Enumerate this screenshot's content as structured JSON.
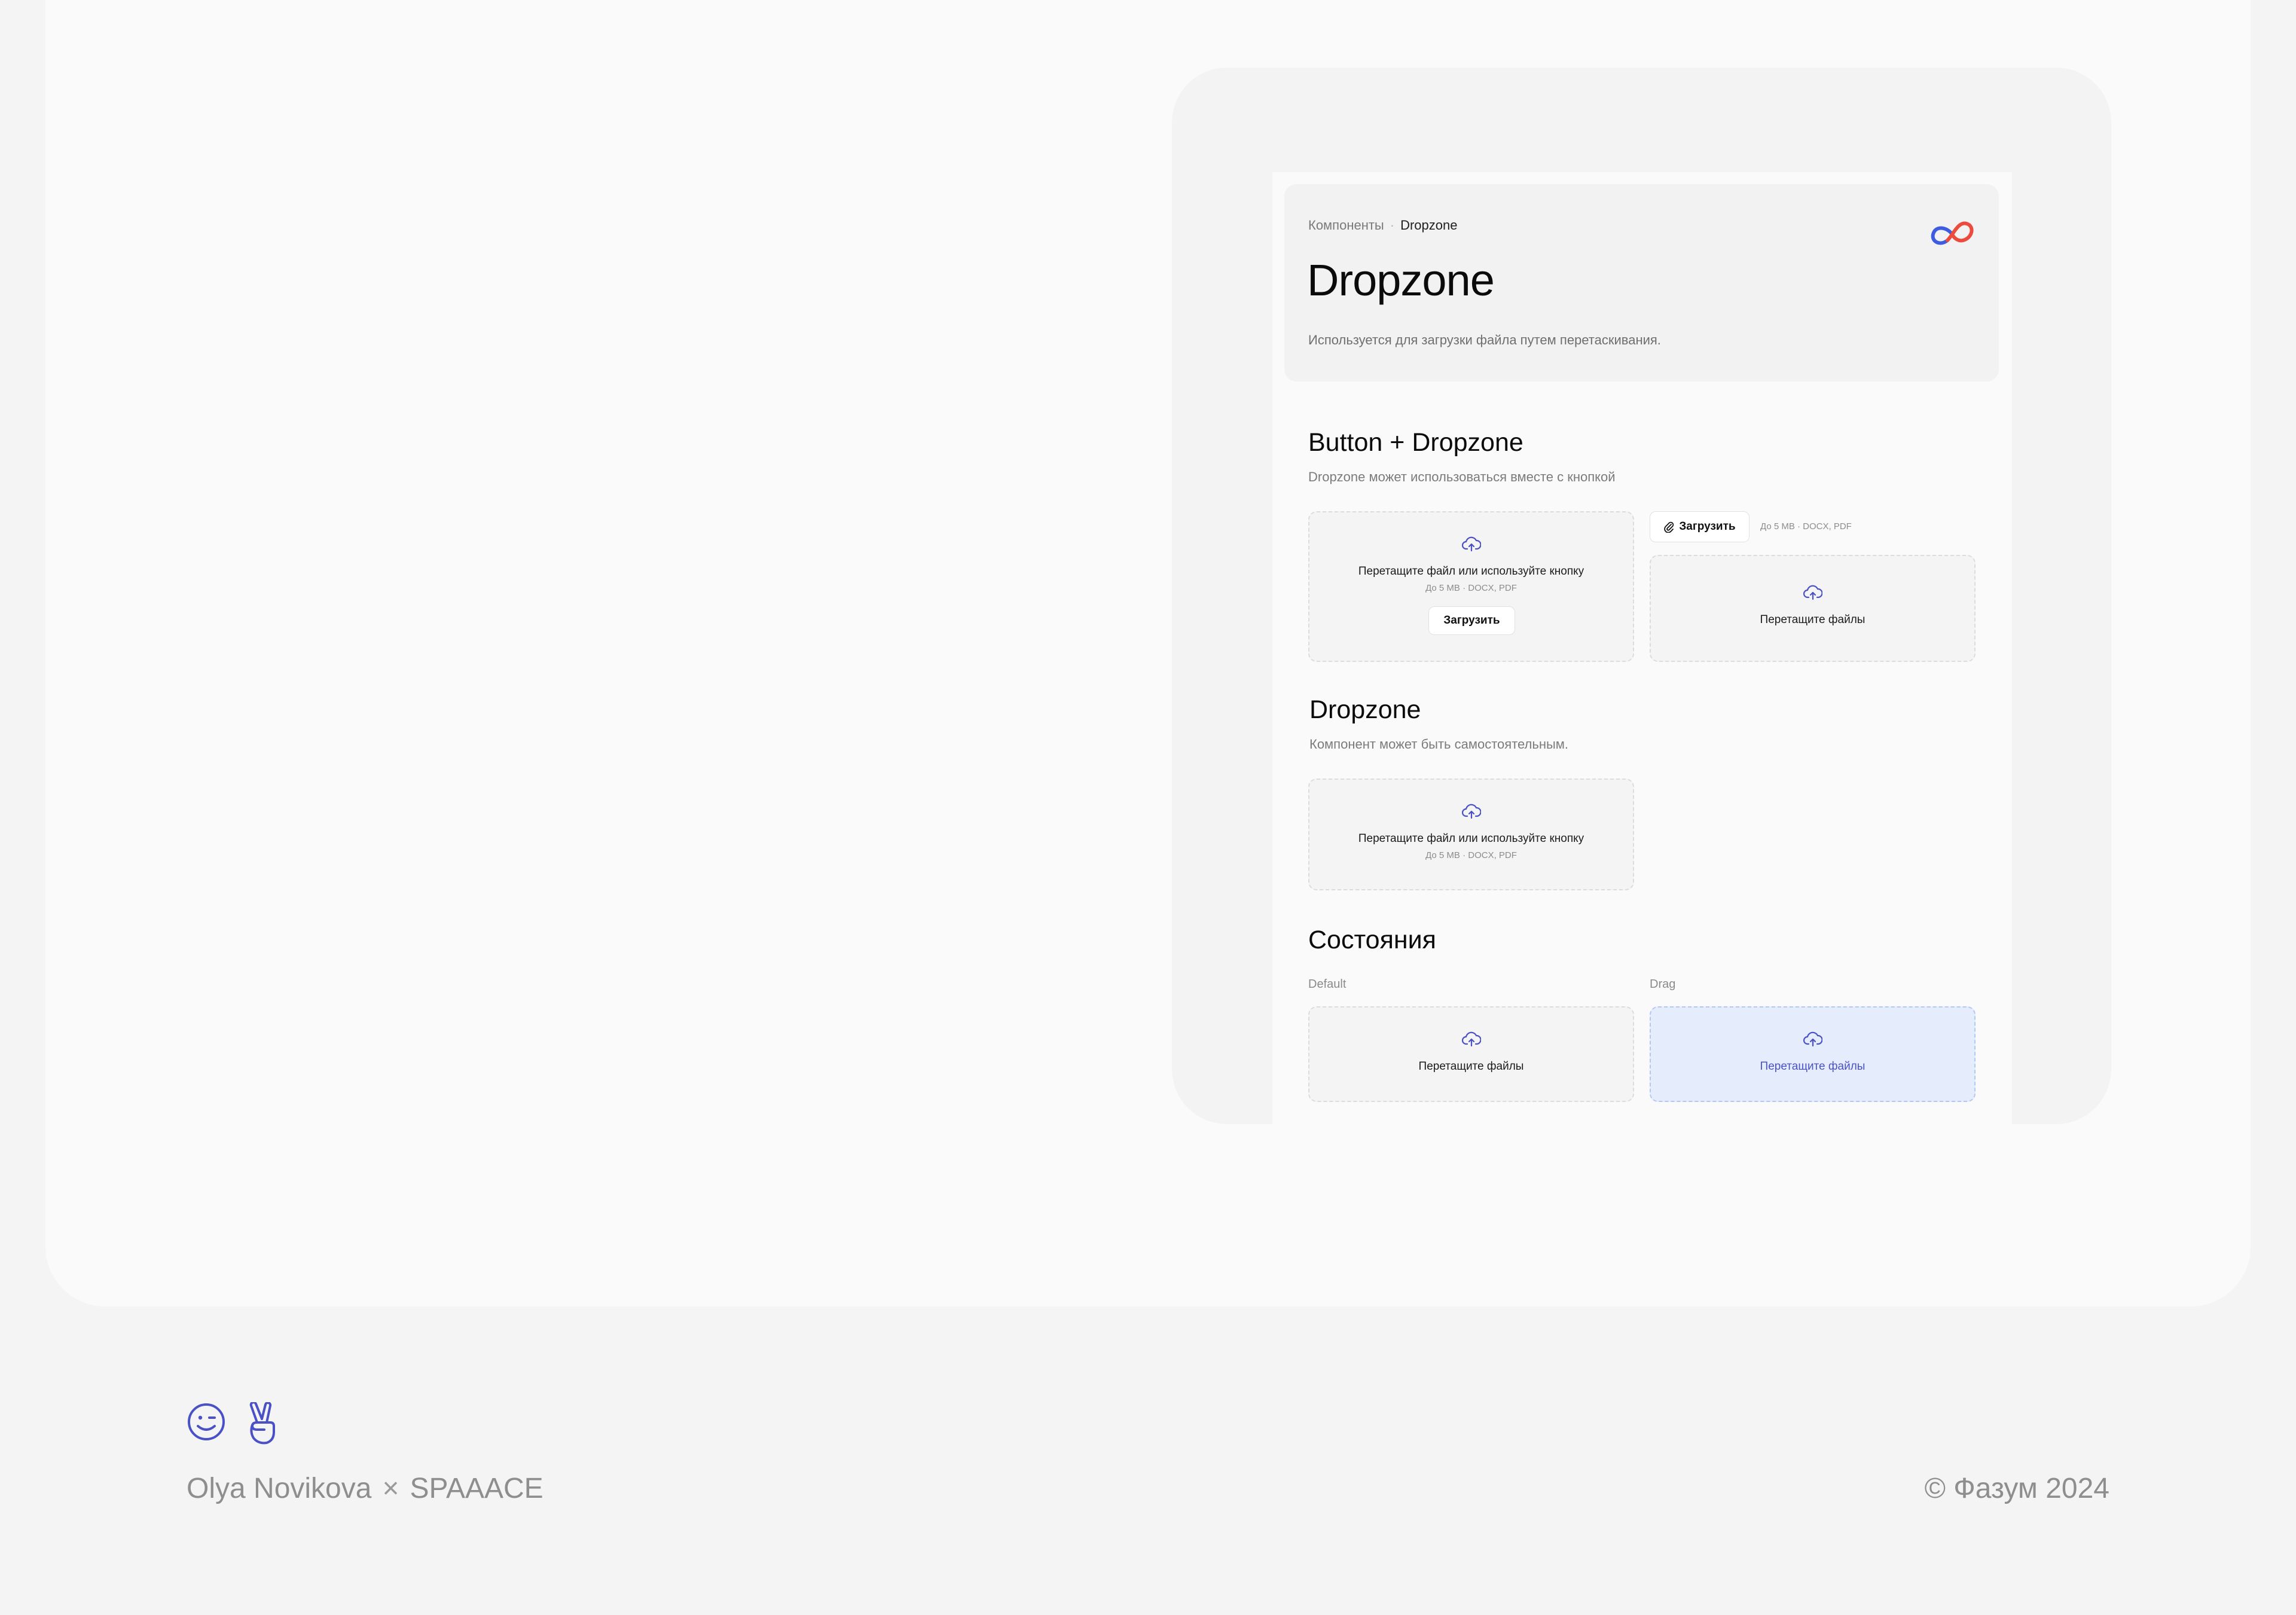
{
  "breadcrumb": {
    "parent": "Компоненты",
    "separator": "·",
    "current": "Dropzone"
  },
  "header": {
    "title": "Dropzone",
    "description": "Используется для загрузки файла путем перетаскивания."
  },
  "sections": {
    "button_dropzone": {
      "title": "Button + Dropzone",
      "subtitle": "Dropzone может использоваться вместе с кнопкой",
      "zone_full": {
        "text": "Перетащите файл или используйте кнопку",
        "hint": "До 5 MB · DOCX, PDF",
        "button": "Загрузить"
      },
      "upload_button": "Загрузить",
      "upload_hint": "До 5 MB · DOCX, PDF",
      "zone_compact": {
        "text": "Перетащите файлы"
      }
    },
    "dropzone": {
      "title": "Dropzone",
      "subtitle": "Компонент может быть самостоятельным.",
      "zone": {
        "text": "Перетащите файл или используйте кнопку",
        "hint": "До 5 MB · DOCX, PDF"
      }
    },
    "states": {
      "title": "Состояния",
      "default": {
        "label": "Default",
        "text": "Перетащите файлы"
      },
      "drag": {
        "label": "Drag",
        "text": "Перетащите файлы"
      }
    }
  },
  "footer": {
    "author": "Olya Novikova",
    "cross": "×",
    "studio": "SPAAACE",
    "copyright": "© Фазум 2024"
  },
  "icons": {
    "cloud": "cloud-upload-icon",
    "clip": "paperclip-icon",
    "logo": "infinity-logo",
    "smile": "smile-icon",
    "victory": "victory-hand-icon"
  },
  "colors": {
    "accent": "#4a51c6",
    "drag_bg": "#e5edfd",
    "logo_blue": "#3d5ce0",
    "logo_red": "#ec4a3c"
  }
}
